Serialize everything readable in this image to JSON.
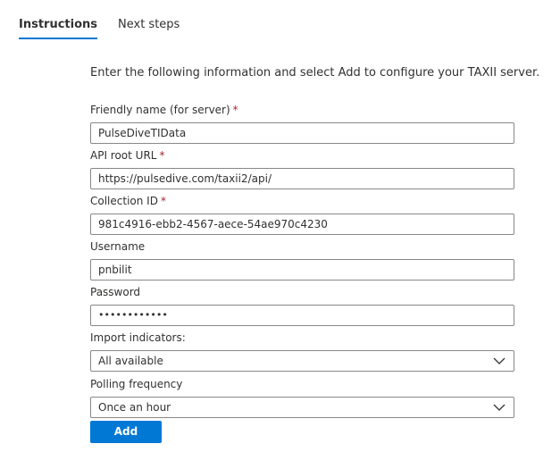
{
  "tabs": [
    {
      "label": "Instructions",
      "active": true
    },
    {
      "label": "Next steps",
      "active": false
    }
  ],
  "intro": "Enter the following information and select Add to configure your TAXII server.",
  "fields": {
    "friendly_name": {
      "label": "Friendly name (for server)",
      "required": "*",
      "value": "PulseDiveTIData"
    },
    "api_root": {
      "label": "API root URL",
      "required": "*",
      "value": "https://pulsedive.com/taxii2/api/"
    },
    "collection_id": {
      "label": "Collection ID",
      "required": "*",
      "value": "981c4916-ebb2-4567-aece-54ae970c4230"
    },
    "username": {
      "label": "Username",
      "value": "pnbilit"
    },
    "password": {
      "label": "Password",
      "value": "••••••••••••"
    },
    "import_indicators": {
      "label": "Import indicators:",
      "value": "All available"
    },
    "polling_frequency": {
      "label": "Polling frequency",
      "value": "Once an hour"
    }
  },
  "add_button": {
    "label": "Add"
  },
  "icons": {
    "dropdown": "chevron-down-icon"
  },
  "colors": {
    "accent": "#0078d4",
    "required": "#a4262c",
    "border": "#8a8886",
    "text": "#323130"
  }
}
